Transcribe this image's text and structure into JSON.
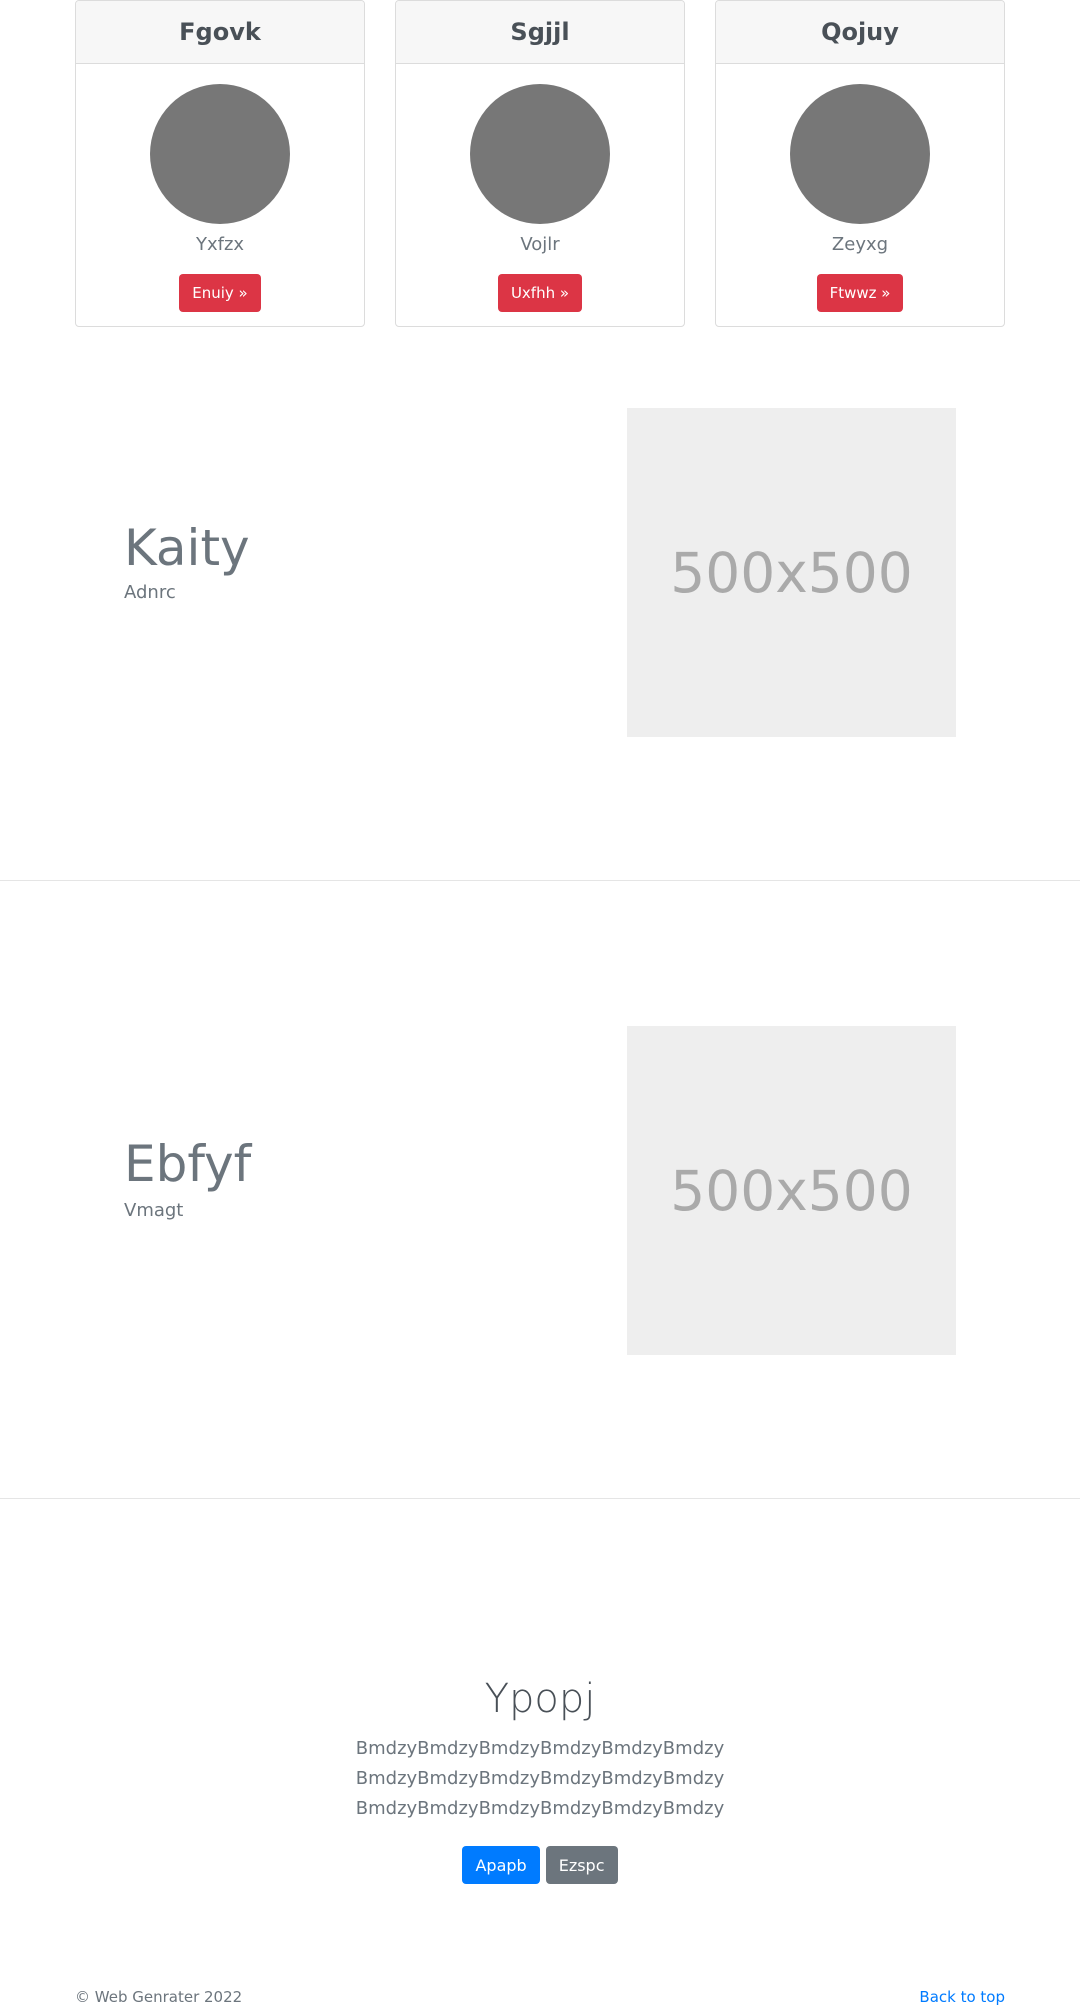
{
  "cards": [
    {
      "header": "Fgovk",
      "subtitle": "Yxfzx",
      "button": "Enuiy »"
    },
    {
      "header": "Sgjjl",
      "subtitle": "Vojlr",
      "button": "Uxfhh »"
    },
    {
      "header": "Qojuy",
      "subtitle": "Zeyxg",
      "button": "Ftwwz »"
    }
  ],
  "features": [
    {
      "title": "Kaity",
      "subtitle": "Adnrc",
      "image_label": "500x500"
    },
    {
      "title": "Ebfyf",
      "subtitle": "Vmagt",
      "image_label": "500x500"
    }
  ],
  "jumbotron": {
    "title": "Ypopj",
    "lines": [
      "BmdzyBmdzyBmdzyBmdzyBmdzyBmdzy",
      "BmdzyBmdzyBmdzyBmdzyBmdzyBmdzy",
      "BmdzyBmdzyBmdzyBmdzyBmdzyBmdzy"
    ],
    "primary_button": "Apapb",
    "secondary_button": "Ezspc"
  },
  "footer": {
    "copyright": "© Web Genrater 2022",
    "back_to_top": "Back to top"
  },
  "colors": {
    "danger": "#dc3545",
    "primary": "#007bff",
    "secondary": "#6c757d",
    "avatar": "#777777",
    "placeholder_bg": "#eeeeee"
  }
}
